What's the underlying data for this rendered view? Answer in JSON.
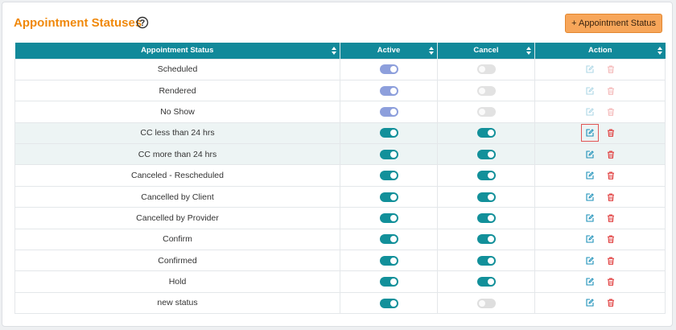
{
  "page": {
    "title": "Appointment Statuses",
    "add_button_label": "+ Appointment Status"
  },
  "colors": {
    "accent": "#f0880a",
    "header_bg": "#11899a",
    "toggle_on": "#12909a",
    "edit_icon": "#1a8fb8",
    "delete_icon": "#e03b3b"
  },
  "table": {
    "columns": [
      "Appointment Status",
      "Active",
      "Cancel",
      "Action"
    ],
    "rows": [
      {
        "status": "Scheduled",
        "active": true,
        "cancel": false,
        "editable": false,
        "highlighted": false
      },
      {
        "status": "Rendered",
        "active": true,
        "cancel": false,
        "editable": false,
        "highlighted": false
      },
      {
        "status": "No Show",
        "active": true,
        "cancel": false,
        "editable": false,
        "highlighted": false
      },
      {
        "status": "CC less than 24 hrs",
        "active": true,
        "cancel": true,
        "editable": true,
        "highlighted": true
      },
      {
        "status": "CC more than 24 hrs",
        "active": true,
        "cancel": true,
        "editable": true,
        "highlighted": true
      },
      {
        "status": "Canceled - Rescheduled",
        "active": true,
        "cancel": true,
        "editable": true,
        "highlighted": false
      },
      {
        "status": "Cancelled by Client",
        "active": true,
        "cancel": true,
        "editable": true,
        "highlighted": false
      },
      {
        "status": "Cancelled by Provider",
        "active": true,
        "cancel": true,
        "editable": true,
        "highlighted": false
      },
      {
        "status": "Confirm",
        "active": true,
        "cancel": true,
        "editable": true,
        "highlighted": false
      },
      {
        "status": "Confirmed",
        "active": true,
        "cancel": true,
        "editable": true,
        "highlighted": false
      },
      {
        "status": "Hold",
        "active": true,
        "cancel": true,
        "editable": true,
        "highlighted": false
      },
      {
        "status": "new status",
        "active": true,
        "cancel": false,
        "editable": true,
        "highlighted": false
      }
    ],
    "focused_edit_row": 3
  }
}
